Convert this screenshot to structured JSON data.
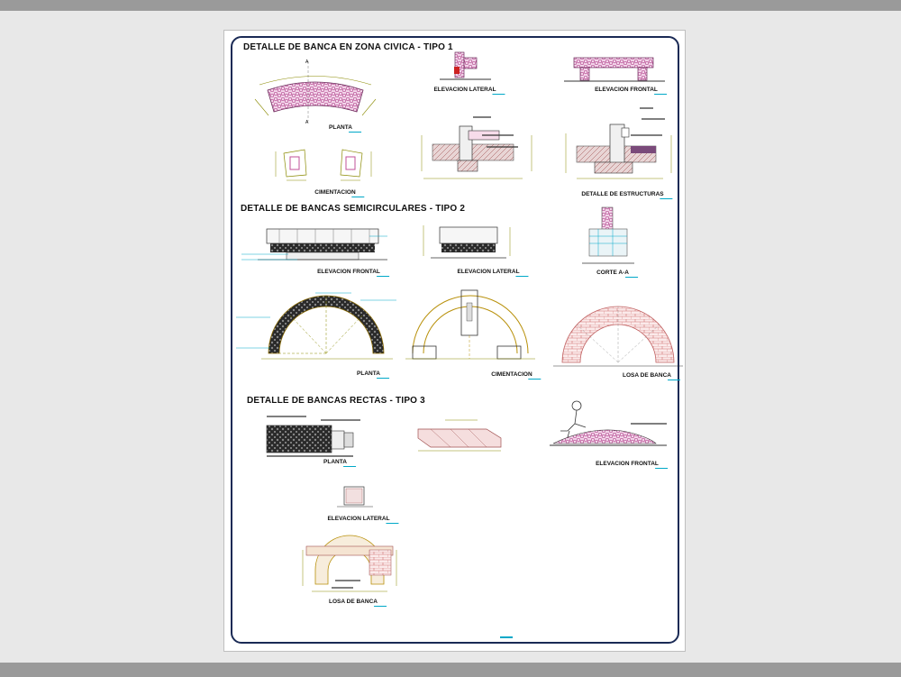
{
  "titles": {
    "tipo1": "DETALLE DE BANCA EN ZONA CIVICA -  TIPO 1",
    "tipo2": "DETALLE DE BANCAS SEMICIRCULARES -  TIPO 2",
    "tipo3": "DETALLE DE BANCAS RECTAS -  TIPO 3"
  },
  "labels": {
    "planta_1": "PLANTA",
    "elev_lateral_1": "ELEVACION LATERAL",
    "elev_frontal_1": "ELEVACION FRONTAL",
    "cimentacion_1": "CIMENTACION",
    "detalle_estructuras": "DETALLE DE ESTRUCTURAS",
    "elev_frontal_2": "ELEVACION FRONTAL",
    "elev_lateral_2": "ELEVACION LATERAL",
    "corte_aa": "CORTE A-A",
    "planta_2": "PLANTA",
    "cimentacion_2": "CIMENTACION",
    "losa_banca_2": "LOSA DE BANCA",
    "planta_3": "PLANTA",
    "elev_frontal_3": "ELEVACION FRONTAL",
    "elev_lateral_3": "ELEVACION LATERAL",
    "losa_banca_3": "LOSA DE BANCA"
  },
  "section_marks": {
    "top": "A",
    "bottom": "A"
  },
  "colors": {
    "frame": "#1a2a55",
    "stone": "#c0509a",
    "dimension": "#8a8a00",
    "annotation": "#00a8c8",
    "gold": "#b8900a",
    "brick": "#d07070"
  }
}
